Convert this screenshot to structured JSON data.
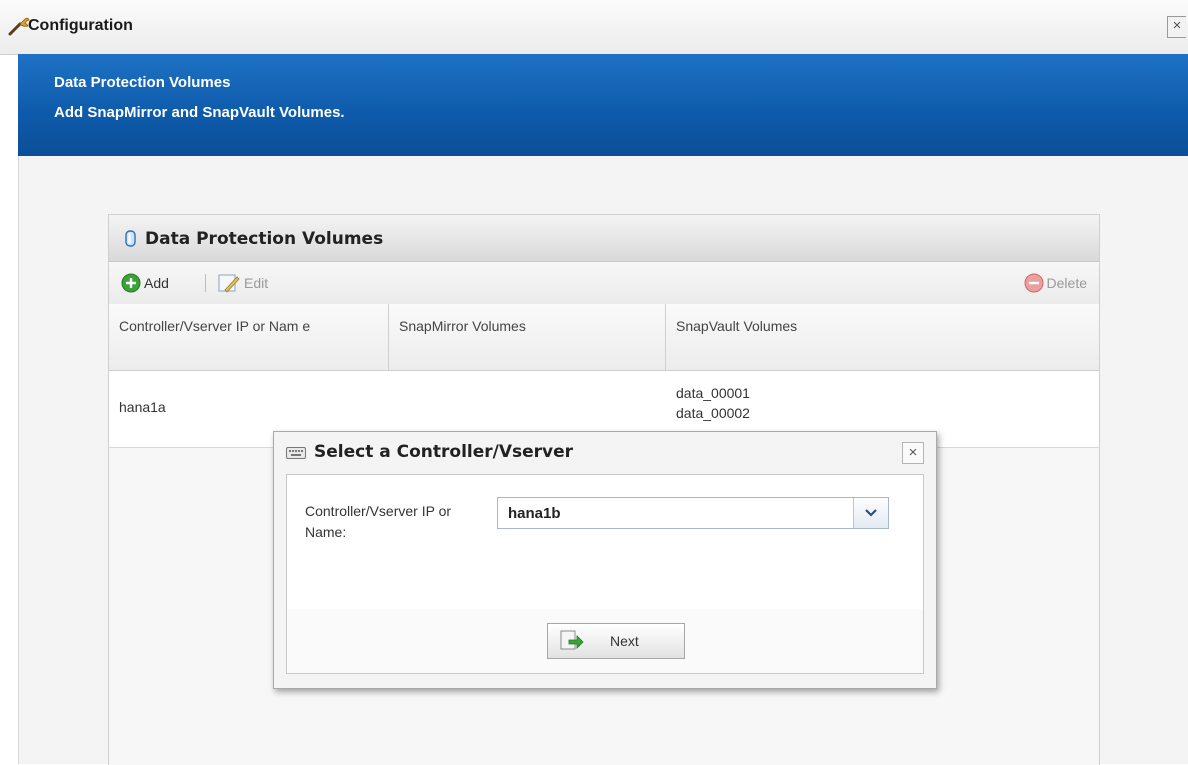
{
  "window": {
    "title": "Configuration",
    "close_label": "×"
  },
  "banner": {
    "heading": "Data Protection Volumes",
    "subheading": "Add SnapMirror and SnapVault Volumes."
  },
  "panel": {
    "title": "Data Protection Volumes",
    "toolbar": {
      "add_label": "Add",
      "edit_label": "Edit",
      "delete_label": "Delete"
    },
    "columns": [
      "Controller/Vserver IP or Nam e",
      "SnapMirror Volumes",
      "SnapVault Volumes"
    ],
    "rows": [
      {
        "controller": "hana1a",
        "snapmirror": "",
        "snapvault": [
          "data_00001",
          "data_00002"
        ]
      }
    ]
  },
  "dialog": {
    "title": "Select a Controller/Vserver",
    "close_label": "×",
    "field_label": "Controller/Vserver IP or Name:",
    "field_value": "hana1b",
    "next_label": "Next"
  },
  "colors": {
    "banner": "#0e5aaa",
    "add_icon": "#3aa337",
    "delete_icon": "#d9534f"
  }
}
